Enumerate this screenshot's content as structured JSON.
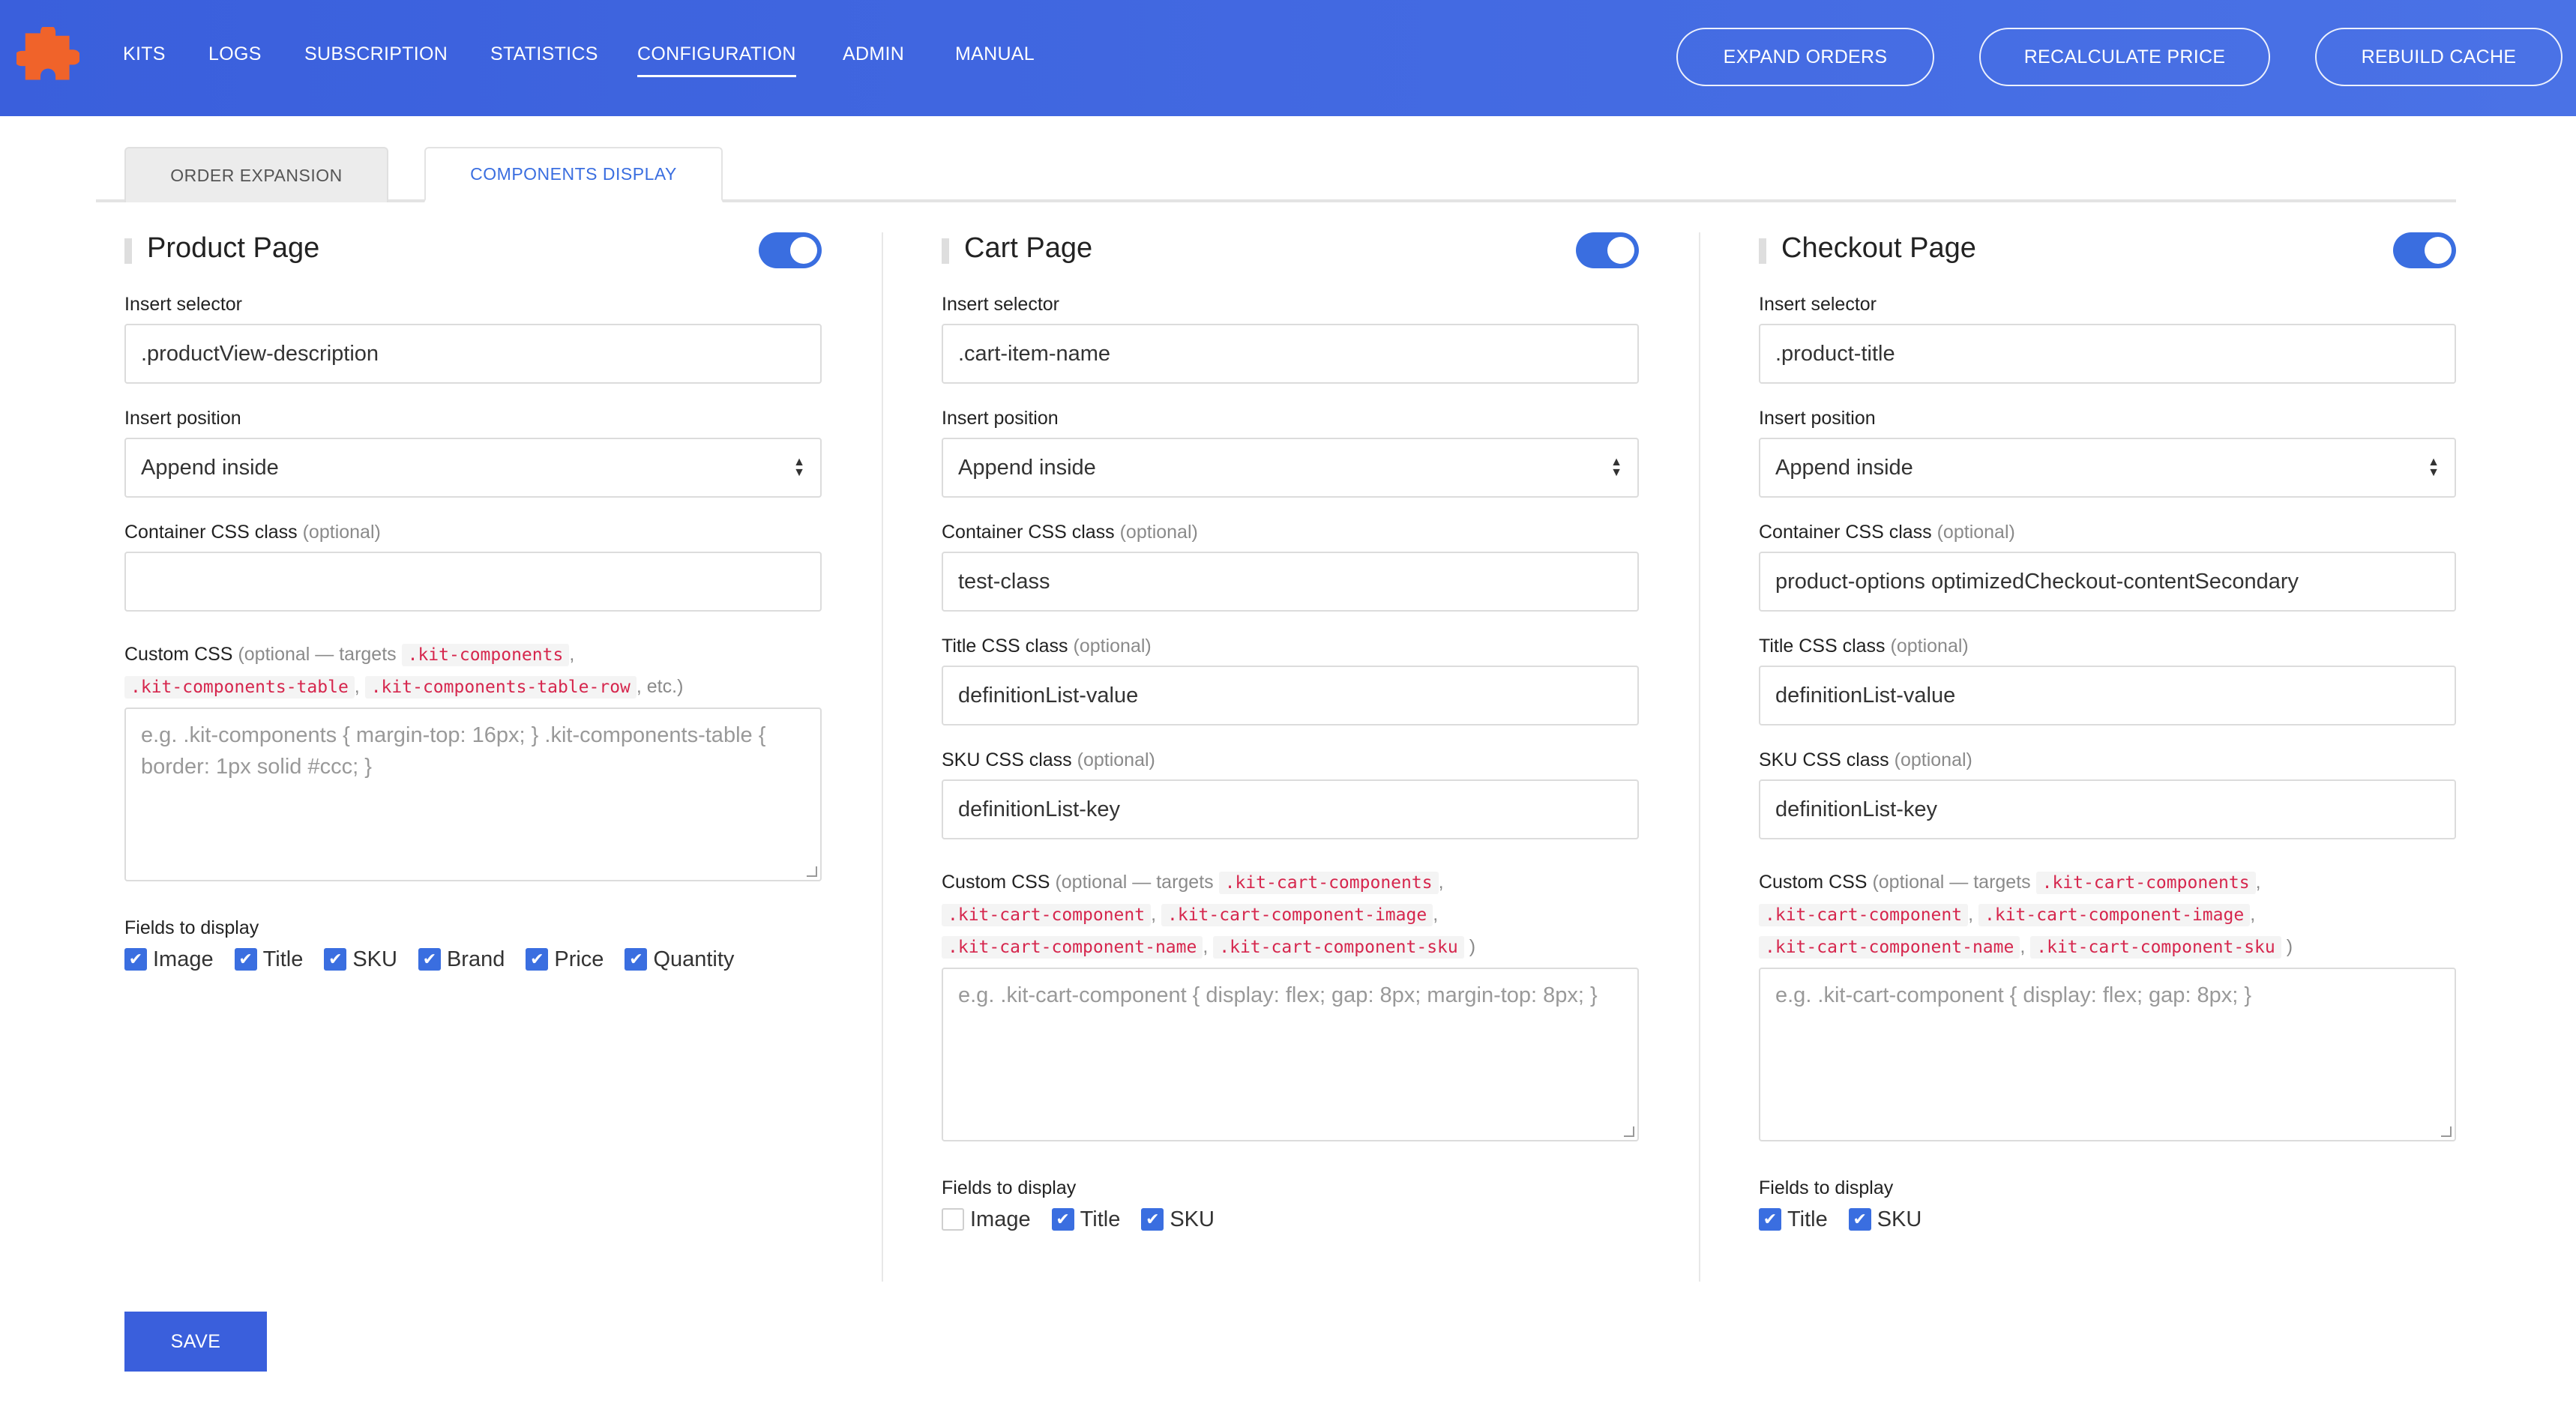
{
  "colors": {
    "topbar": "#3a5fdc",
    "accent": "#3a6ee0",
    "code": "#d6264d"
  },
  "logo": {
    "icon": "puzzle-piece-icon",
    "color": "#f0632a"
  },
  "nav": {
    "items": [
      {
        "label": "KITS"
      },
      {
        "label": "LOGS"
      },
      {
        "label": "SUBSCRIPTION"
      },
      {
        "label": "STATISTICS"
      },
      {
        "label": "CONFIGURATION"
      },
      {
        "label": "ADMIN"
      },
      {
        "label": "MANUAL"
      }
    ],
    "active": "CONFIGURATION"
  },
  "actions": {
    "expand": "EXPAND ORDERS",
    "recalc": "RECALCULATE PRICE",
    "rebuild": "REBUILD CACHE"
  },
  "tabs": [
    {
      "label": "ORDER EXPANSION"
    },
    {
      "label": "COMPONENTS DISPLAY"
    }
  ],
  "labels": {
    "insert_selector": "Insert selector",
    "insert_position": "Insert position",
    "container_css": "Container CSS class",
    "title_css": "Title CSS class",
    "sku_css": "SKU CSS class",
    "custom_css": "Custom CSS",
    "optional": "(optional)",
    "optional_targets": "(optional — targets",
    "fields_to_display": "Fields to display"
  },
  "product": {
    "title": "Product Page",
    "enabled": true,
    "insert_selector": ".productView-description",
    "insert_position": "Append inside",
    "container_css": "",
    "code1": ".kit-components",
    "code2": ".kit-components-table",
    "code3": ".kit-components-table-row",
    "etc": ", etc.)",
    "placeholder": "e.g. .kit-components { margin-top: 16px; } .kit-components-table { border: 1px solid #ccc; }",
    "fields": [
      {
        "label": "Image",
        "checked": true
      },
      {
        "label": "Title",
        "checked": true
      },
      {
        "label": "SKU",
        "checked": true
      },
      {
        "label": "Brand",
        "checked": true
      },
      {
        "label": "Price",
        "checked": true
      },
      {
        "label": "Quantity",
        "checked": true
      }
    ]
  },
  "cart": {
    "title": "Cart Page",
    "enabled": true,
    "insert_selector": ".cart-item-name",
    "insert_position": "Append inside",
    "container_css": "test-class",
    "title_css": "definitionList-value",
    "sku_css": "definitionList-key",
    "code1": ".kit-cart-components",
    "code2": ".kit-cart-component",
    "code3": ".kit-cart-component-image",
    "code4": ".kit-cart-component-name",
    "code5": ".kit-cart-component-sku",
    "placeholder": "e.g. .kit-cart-component { display: flex; gap: 8px; margin-top: 8px; }",
    "fields": [
      {
        "label": "Image",
        "checked": false
      },
      {
        "label": "Title",
        "checked": true
      },
      {
        "label": "SKU",
        "checked": true
      }
    ]
  },
  "checkout": {
    "title": "Checkout Page",
    "enabled": true,
    "insert_selector": ".product-title",
    "insert_position": "Append inside",
    "container_css": "product-options optimizedCheckout-contentSecondary",
    "title_css": "definitionList-value",
    "sku_css": "definitionList-key",
    "code1": ".kit-cart-components",
    "code2": ".kit-cart-component",
    "code3": ".kit-cart-component-image",
    "code4": ".kit-cart-component-name",
    "code5": ".kit-cart-component-sku",
    "placeholder": "e.g. .kit-cart-component { display: flex; gap: 8px; }",
    "fields": [
      {
        "label": "Title",
        "checked": true
      },
      {
        "label": "SKU",
        "checked": true
      }
    ]
  },
  "save_label": "SAVE"
}
